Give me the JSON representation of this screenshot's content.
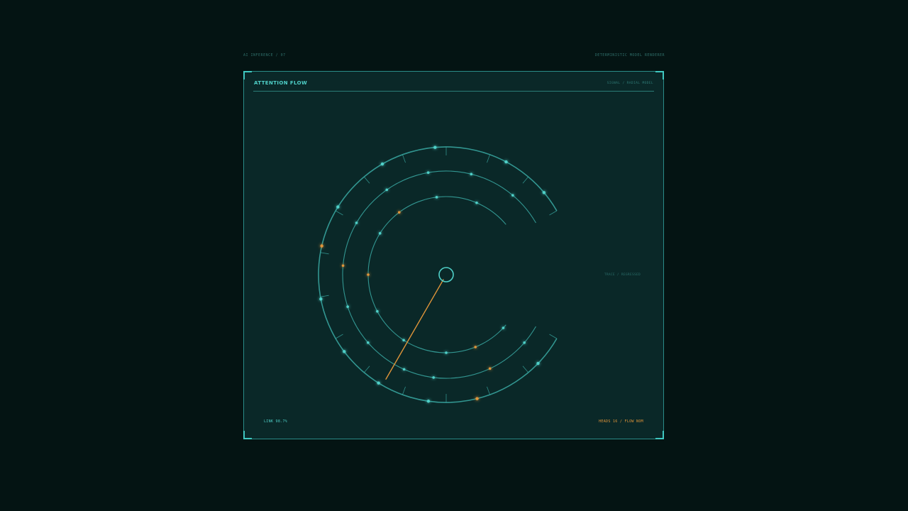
{
  "header": {
    "left_label": "AI INFERENCE / 07",
    "right_label": "DETERMINISTIC MODEL RENDERER"
  },
  "panel": {
    "title": "ATTENTION FLOW",
    "subtitle": "SIGNAL / RADIAL MODEL",
    "side_label": "TRACE / REGRESSED",
    "footer_left": "LINK 98.7%",
    "footer_right": "HEADS 16 / FLOW NOM"
  },
  "colors": {
    "accent": "#4fd0c8",
    "ring": "#3aa9a3",
    "warning": "#e0953a",
    "panel_bg": "#0a2828",
    "page_bg": "#041413"
  },
  "pointer": {
    "angle_deg": 240
  },
  "rings": [
    {
      "name": "outer",
      "start_deg": 30,
      "end_deg": 330,
      "nodes": [
        {
          "angle_deg": 95,
          "warm": false
        },
        {
          "angle_deg": 62,
          "warm": false
        },
        {
          "angle_deg": 40,
          "warm": false
        },
        {
          "angle_deg": 120,
          "warm": false
        },
        {
          "angle_deg": 148,
          "warm": false
        },
        {
          "angle_deg": 167,
          "warm": true
        },
        {
          "angle_deg": 191,
          "warm": false
        },
        {
          "angle_deg": 217,
          "warm": false
        },
        {
          "angle_deg": 238,
          "warm": false
        },
        {
          "angle_deg": 262,
          "warm": false
        },
        {
          "angle_deg": 284,
          "warm": true
        },
        {
          "angle_deg": 316,
          "warm": false
        }
      ]
    },
    {
      "name": "middle",
      "start_deg": 30,
      "end_deg": 330,
      "nodes": [
        {
          "angle_deg": 100,
          "warm": false
        },
        {
          "angle_deg": 76,
          "warm": false
        },
        {
          "angle_deg": 50,
          "warm": false
        },
        {
          "angle_deg": 125,
          "warm": false
        },
        {
          "angle_deg": 150,
          "warm": false
        },
        {
          "angle_deg": 175,
          "warm": true
        },
        {
          "angle_deg": 198,
          "warm": false
        },
        {
          "angle_deg": 221,
          "warm": false
        },
        {
          "angle_deg": 246,
          "warm": false
        },
        {
          "angle_deg": 263,
          "warm": false
        },
        {
          "angle_deg": 295,
          "warm": true
        },
        {
          "angle_deg": 319,
          "warm": false
        }
      ]
    },
    {
      "name": "inner",
      "start_deg": 40,
      "end_deg": 320,
      "nodes": [
        {
          "angle_deg": 97,
          "warm": false
        },
        {
          "angle_deg": 67,
          "warm": false
        },
        {
          "angle_deg": 127,
          "warm": true
        },
        {
          "angle_deg": 148,
          "warm": false
        },
        {
          "angle_deg": 180,
          "warm": true
        },
        {
          "angle_deg": 208,
          "warm": false
        },
        {
          "angle_deg": 237,
          "warm": false
        },
        {
          "angle_deg": 270,
          "warm": false
        },
        {
          "angle_deg": 292,
          "warm": true
        },
        {
          "angle_deg": 317,
          "warm": false
        }
      ]
    }
  ]
}
